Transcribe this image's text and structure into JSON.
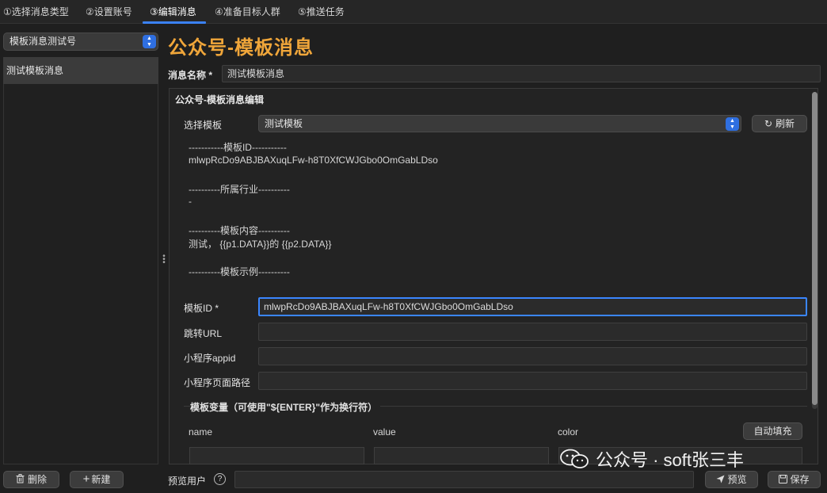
{
  "tabs": [
    {
      "label": "①选择消息类型"
    },
    {
      "label": "②设置账号"
    },
    {
      "label": "③编辑消息"
    },
    {
      "label": "④准备目标人群"
    },
    {
      "label": "⑤推送任务"
    }
  ],
  "sidebar": {
    "account_select": "模板消息测试号",
    "items": [
      {
        "label": "测试模板消息"
      }
    ],
    "delete_label": "删除",
    "new_label": "新建"
  },
  "main": {
    "title": "公众号-模板消息",
    "message_name_label": "消息名称 *",
    "message_name_value": "测试模板消息",
    "group_title": "公众号-模板消息编辑",
    "select_template_label": "选择模板",
    "select_template_value": "测试模板",
    "refresh_label": "刷新",
    "info": {
      "id_header": "-----------模板ID-----------",
      "id_value": "mlwpRcDo9ABJBAXuqLFw-h8T0XfCWJGbo0OmGabLDso",
      "industry_header": "----------所属行业----------",
      "industry_value": "-",
      "content_header": "----------模板内容----------",
      "content_value": "测试， {{p1.DATA}}的 {{p2.DATA}}",
      "example_header": "----------模板示例----------"
    },
    "fields": {
      "template_id_label": "模板ID *",
      "template_id_value": "mlwpRcDo9ABJBAXuqLFw-h8T0XfCWJGbo0OmGabLDso",
      "jump_url_label": "跳转URL",
      "jump_url_value": "",
      "mini_appid_label": "小程序appid",
      "mini_appid_value": "",
      "mini_path_label": "小程序页面路径",
      "mini_path_value": ""
    },
    "vars": {
      "title": "模板变量（可使用\"${ENTER}\"作为换行符）",
      "col_name": "name",
      "col_value": "value",
      "col_color": "color",
      "autofill_label": "自动填充"
    }
  },
  "footer": {
    "preview_user_label": "预览用户",
    "preview_user_value": "",
    "preview_label": "预览",
    "save_label": "保存"
  },
  "watermark": "公众号 · soft张三丰"
}
